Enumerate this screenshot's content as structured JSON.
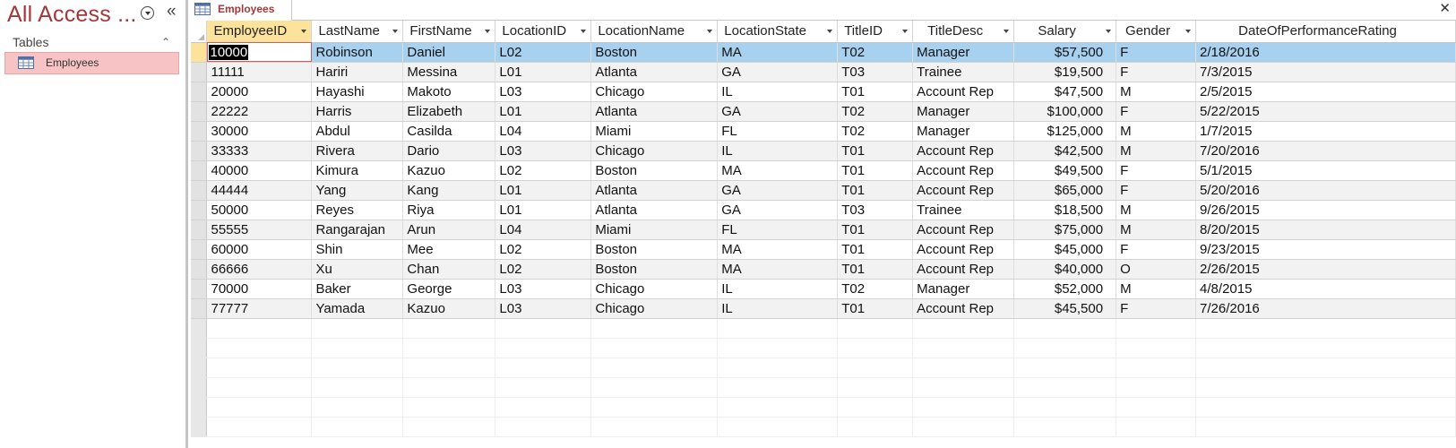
{
  "nav": {
    "title": "All Access ...",
    "group_label": "Tables",
    "items": [
      {
        "label": "Employees"
      }
    ]
  },
  "document": {
    "tab_label": "Employees",
    "close_glyph": "✕"
  },
  "colors": {
    "brand": "#a4373a",
    "selected_nav": "#f7c3c4",
    "current_row": "#a8d1f0",
    "selected_column_header": "#fce39c"
  },
  "grid": {
    "columns": [
      {
        "label": "EmployeeID",
        "key": "employee_id"
      },
      {
        "label": "LastName",
        "key": "last_name"
      },
      {
        "label": "FirstName",
        "key": "first_name"
      },
      {
        "label": "LocationID",
        "key": "location_id"
      },
      {
        "label": "LocationName",
        "key": "location_name"
      },
      {
        "label": "LocationState",
        "key": "location_state"
      },
      {
        "label": "TitleID",
        "key": "title_id"
      },
      {
        "label": "TitleDesc",
        "key": "title_desc"
      },
      {
        "label": "Salary",
        "key": "salary"
      },
      {
        "label": "Gender",
        "key": "gender"
      },
      {
        "label": "DateOfPerformanceRating",
        "key": "date_of_performance_rating"
      }
    ],
    "rows": [
      [
        "10000",
        "Robinson",
        "Daniel",
        "L02",
        "Boston",
        "MA",
        "T02",
        "Manager",
        "$57,500",
        "F",
        "2/18/2016"
      ],
      [
        "11111",
        "Hariri",
        "Messina",
        "L01",
        "Atlanta",
        "GA",
        "T03",
        "Trainee",
        "$19,500",
        "F",
        "7/3/2015"
      ],
      [
        "20000",
        "Hayashi",
        "Makoto",
        "L03",
        "Chicago",
        "IL",
        "T01",
        "Account Rep",
        "$47,500",
        "M",
        "2/5/2015"
      ],
      [
        "22222",
        "Harris",
        "Elizabeth",
        "L01",
        "Atlanta",
        "GA",
        "T02",
        "Manager",
        "$100,000",
        "F",
        "5/22/2015"
      ],
      [
        "30000",
        "Abdul",
        "Casilda",
        "L04",
        "Miami",
        "FL",
        "T02",
        "Manager",
        "$125,000",
        "M",
        "1/7/2015"
      ],
      [
        "33333",
        "Rivera",
        "Dario",
        "L03",
        "Chicago",
        "IL",
        "T01",
        "Account Rep",
        "$42,500",
        "M",
        "7/20/2016"
      ],
      [
        "40000",
        "Kimura",
        "Kazuo",
        "L02",
        "Boston",
        "MA",
        "T01",
        "Account Rep",
        "$49,500",
        "F",
        "5/1/2015"
      ],
      [
        "44444",
        "Yang",
        "Kang",
        "L01",
        "Atlanta",
        "GA",
        "T01",
        "Account Rep",
        "$65,000",
        "F",
        "5/20/2016"
      ],
      [
        "50000",
        "Reyes",
        "Riya",
        "L01",
        "Atlanta",
        "GA",
        "T03",
        "Trainee",
        "$18,500",
        "M",
        "9/26/2015"
      ],
      [
        "55555",
        "Rangarajan",
        "Arun",
        "L04",
        "Miami",
        "FL",
        "T01",
        "Account Rep",
        "$75,000",
        "M",
        "8/20/2015"
      ],
      [
        "60000",
        "Shin",
        "Mee",
        "L02",
        "Boston",
        "MA",
        "T01",
        "Account Rep",
        "$45,000",
        "F",
        "9/23/2015"
      ],
      [
        "66666",
        "Xu",
        "Chan",
        "L02",
        "Boston",
        "MA",
        "T01",
        "Account Rep",
        "$40,000",
        "O",
        "2/26/2015"
      ],
      [
        "70000",
        "Baker",
        "George",
        "L03",
        "Chicago",
        "IL",
        "T02",
        "Manager",
        "$52,000",
        "M",
        "4/8/2015"
      ],
      [
        "77777",
        "Yamada",
        "Kazuo",
        "L03",
        "Chicago",
        "IL",
        "T01",
        "Account Rep",
        "$45,500",
        "F",
        "7/26/2016"
      ]
    ]
  }
}
